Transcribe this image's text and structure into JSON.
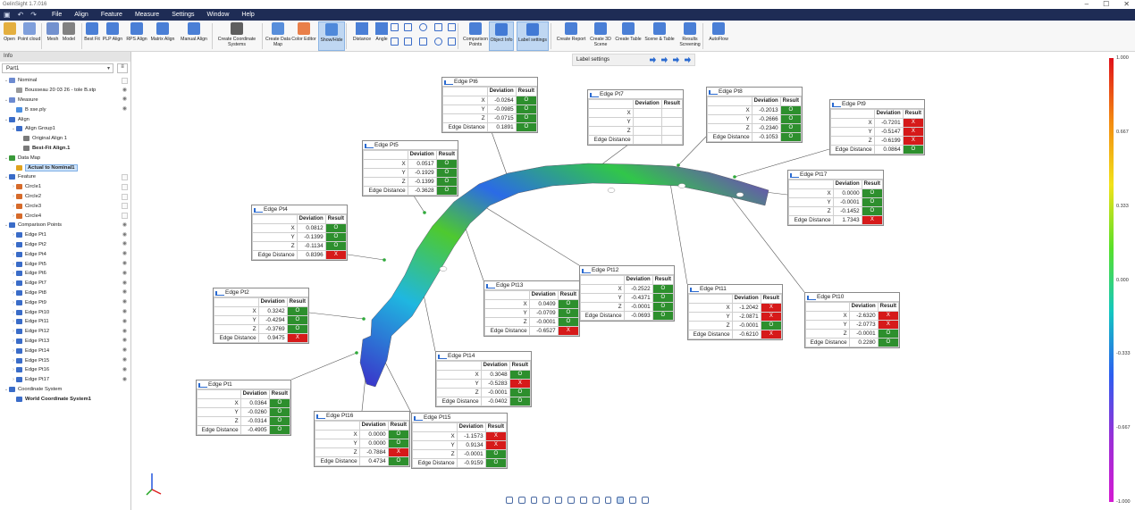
{
  "app": {
    "title": "GelinSight 1.7.016"
  },
  "menu": [
    "File",
    "Align",
    "Feature",
    "Measure",
    "Settings",
    "Window",
    "Help"
  ],
  "ribbon": {
    "buttons": [
      {
        "label": "Open",
        "icon": "folder-open-icon"
      },
      {
        "label": "Point cloud",
        "icon": "point-cloud-icon"
      },
      {
        "label": "Mesh",
        "icon": "mesh-icon"
      },
      {
        "label": "Model",
        "icon": "model-icon"
      },
      {
        "label": "Best Fit",
        "icon": "best-fit-icon"
      },
      {
        "label": "PLP Align",
        "icon": "plp-align-icon"
      },
      {
        "label": "RPS Align",
        "icon": "rps-align-icon"
      },
      {
        "label": "Matrix Align",
        "icon": "matrix-align-icon"
      },
      {
        "label": "Manual Align",
        "icon": "manual-align-icon"
      },
      {
        "label": "Create Coordinate Systems",
        "icon": "coordinate-system-icon"
      },
      {
        "label": "Create Data Map",
        "icon": "data-map-icon"
      },
      {
        "label": "Color Editor",
        "icon": "color-editor-icon"
      },
      {
        "label": "Show/Hide",
        "icon": "show-hide-icon"
      },
      {
        "label": "Distance",
        "icon": "distance-icon"
      },
      {
        "label": "Angle",
        "icon": "angle-icon"
      },
      {
        "label": "Comparison Points",
        "icon": "comparison-points-icon"
      },
      {
        "label": "Object Info",
        "icon": "object-info-icon"
      },
      {
        "label": "Label settings",
        "icon": "label-settings-icon"
      },
      {
        "label": "Create Report",
        "icon": "report-icon"
      },
      {
        "label": "Create 3D Scene",
        "icon": "scene-3d-icon"
      },
      {
        "label": "Create Table",
        "icon": "table-icon"
      },
      {
        "label": "Scene & Table",
        "icon": "scene-table-icon"
      },
      {
        "label": "Results Screening",
        "icon": "results-screening-icon"
      },
      {
        "label": "AutoFlow",
        "icon": "autoflow-icon"
      }
    ]
  },
  "panel": {
    "header": "Info",
    "part": "Part1",
    "tree": [
      {
        "label": "Nominal",
        "level": 0,
        "expander": "v",
        "right": "box"
      },
      {
        "label": "Bousseau 20 03 26 - tole B.stp",
        "level": 1,
        "expander": "",
        "right": "eye"
      },
      {
        "label": "Measure",
        "level": 0,
        "expander": "v",
        "right": "eye"
      },
      {
        "label": "B sse.ply",
        "level": 1,
        "expander": "",
        "right": "eye"
      },
      {
        "label": "Align",
        "level": 0,
        "expander": "v",
        "right": ""
      },
      {
        "label": "Align Group1",
        "level": 1,
        "expander": "v",
        "right": ""
      },
      {
        "label": "Original Align 1",
        "level": 2,
        "expander": "",
        "right": ""
      },
      {
        "label": "Best-Fit Align.1",
        "level": 2,
        "expander": "",
        "right": "",
        "bold": true
      },
      {
        "label": "Data Map",
        "level": 0,
        "expander": "v",
        "right": ""
      },
      {
        "label": "Actual to Nominal1",
        "level": 1,
        "expander": "",
        "right": "",
        "bold": true,
        "selected": true
      },
      {
        "label": "Feature",
        "level": 0,
        "expander": "v",
        "right": "box"
      },
      {
        "label": "Circle1",
        "level": 1,
        "expander": ">",
        "right": "box"
      },
      {
        "label": "Circle2",
        "level": 1,
        "expander": ">",
        "right": "box"
      },
      {
        "label": "Circle3",
        "level": 1,
        "expander": ">",
        "right": "box"
      },
      {
        "label": "Circle4",
        "level": 1,
        "expander": ">",
        "right": "box"
      },
      {
        "label": "Comparison Points",
        "level": 0,
        "expander": "v",
        "right": "eye"
      },
      {
        "label": "Edge Pt1",
        "level": 1,
        "expander": ">",
        "right": "eye"
      },
      {
        "label": "Edge Pt2",
        "level": 1,
        "expander": ">",
        "right": "eye"
      },
      {
        "label": "Edge Pt4",
        "level": 1,
        "expander": ">",
        "right": "eye"
      },
      {
        "label": "Edge Pt5",
        "level": 1,
        "expander": ">",
        "right": "eye"
      },
      {
        "label": "Edge Pt6",
        "level": 1,
        "expander": ">",
        "right": "eye"
      },
      {
        "label": "Edge Pt7",
        "level": 1,
        "expander": ">",
        "right": "eye"
      },
      {
        "label": "Edge Pt8",
        "level": 1,
        "expander": ">",
        "right": "eye"
      },
      {
        "label": "Edge Pt9",
        "level": 1,
        "expander": ">",
        "right": "eye"
      },
      {
        "label": "Edge Pt10",
        "level": 1,
        "expander": ">",
        "right": "eye"
      },
      {
        "label": "Edge Pt11",
        "level": 1,
        "expander": ">",
        "right": "eye"
      },
      {
        "label": "Edge Pt12",
        "level": 1,
        "expander": ">",
        "right": "eye"
      },
      {
        "label": "Edge Pt13",
        "level": 1,
        "expander": ">",
        "right": "eye"
      },
      {
        "label": "Edge Pt14",
        "level": 1,
        "expander": ">",
        "right": "eye"
      },
      {
        "label": "Edge Pt15",
        "level": 1,
        "expander": ">",
        "right": "eye"
      },
      {
        "label": "Edge Pt16",
        "level": 1,
        "expander": ">",
        "right": "eye"
      },
      {
        "label": "Edge Pt17",
        "level": 1,
        "expander": ">",
        "right": "eye"
      },
      {
        "label": "Coordinate System",
        "level": 0,
        "expander": "v",
        "right": ""
      },
      {
        "label": "World Coordinate System1",
        "level": 1,
        "expander": "",
        "right": "",
        "bold": true
      }
    ]
  },
  "label_settings": {
    "title": "Label settings"
  },
  "table_headers": {
    "deviation": "Deviation",
    "result": "Result",
    "edge_distance": "Edge Distance"
  },
  "points": [
    {
      "name": "Edge Pt1",
      "x": "0.0364",
      "y": "-0.0260",
      "z": "-0.0314",
      "ed": "-0.4905",
      "rx": "O",
      "ry": "O",
      "rz": "O",
      "red": "O"
    },
    {
      "name": "Edge Pt2",
      "x": "0.3242",
      "y": "-0.4294",
      "z": "-0.3769",
      "ed": "0.9475",
      "rx": "O",
      "ry": "O",
      "rz": "O",
      "red": "X"
    },
    {
      "name": "Edge Pt4",
      "x": "0.0812",
      "y": "-0.1399",
      "z": "-0.1134",
      "ed": "0.8396",
      "rx": "O",
      "ry": "O",
      "rz": "O",
      "red": "X"
    },
    {
      "name": "Edge Pt5",
      "x": "0.0517",
      "y": "-0.1929",
      "z": "-0.1399",
      "ed": "-0.3628",
      "rx": "O",
      "ry": "O",
      "rz": "O",
      "red": "O"
    },
    {
      "name": "Edge Pt6",
      "x": "-0.0264",
      "y": "-0.0985",
      "z": "-0.0715",
      "ed": "0.1891",
      "rx": "O",
      "ry": "O",
      "rz": "O",
      "red": "O"
    },
    {
      "name": "Edge Pt7",
      "x": "",
      "y": "",
      "z": "",
      "ed": "",
      "rx": "",
      "ry": "",
      "rz": "",
      "red": ""
    },
    {
      "name": "Edge Pt8",
      "x": "-0.2013",
      "y": "-0.2666",
      "z": "-0.2340",
      "ed": "-0.1053",
      "rx": "O",
      "ry": "O",
      "rz": "O",
      "red": "O"
    },
    {
      "name": "Edge Pt9",
      "x": "-0.7201",
      "y": "-0.5147",
      "z": "-0.6199",
      "ed": "0.0864",
      "rx": "X",
      "ry": "X",
      "rz": "X",
      "red": "O"
    },
    {
      "name": "Edge Pt17",
      "x": "0.0000",
      "y": "-0.0001",
      "z": "-0.1452",
      "ed": "1.7343",
      "rx": "O",
      "ry": "O",
      "rz": "O",
      "red": "X"
    },
    {
      "name": "Edge Pt12",
      "x": "-0.2522",
      "y": "-0.4371",
      "z": "-0.0001",
      "ed": "-0.0693",
      "rx": "O",
      "ry": "O",
      "rz": "O",
      "red": "O"
    },
    {
      "name": "Edge Pt13",
      "x": "0.0409",
      "y": "-0.0709",
      "z": "-0.0001",
      "ed": "-0.6527",
      "rx": "O",
      "ry": "O",
      "rz": "O",
      "red": "X"
    },
    {
      "name": "Edge Pt11",
      "x": "-1.2042",
      "y": "-2.0871",
      "z": "-0.0001",
      "ed": "-0.6210",
      "rx": "X",
      "ry": "X",
      "rz": "O",
      "red": "X"
    },
    {
      "name": "Edge Pt10",
      "x": "-2.6320",
      "y": "-2.0773",
      "z": "-0.0001",
      "ed": "0.2280",
      "rx": "X",
      "ry": "X",
      "rz": "O",
      "red": "O"
    },
    {
      "name": "Edge Pt14",
      "x": "0.3048",
      "y": "-0.5283",
      "z": "-0.0001",
      "ed": "-0.0402",
      "rx": "O",
      "ry": "X",
      "rz": "O",
      "red": "O"
    },
    {
      "name": "Edge Pt16",
      "x": "0.0000",
      "y": "0.0000",
      "z": "-0.7884",
      "ed": "0.4734",
      "rx": "O",
      "ry": "O",
      "rz": "X",
      "red": "O"
    },
    {
      "name": "Edge Pt15",
      "x": "-1.1573",
      "y": "0.9134",
      "z": "-0.0001",
      "ed": "-0.9159",
      "rx": "X",
      "ry": "X",
      "rz": "O",
      "red": "O"
    }
  ],
  "colorbar": {
    "labels": [
      "1.000",
      "0.667",
      "0.333",
      "0.000",
      "-0.333",
      "-0.667",
      "-1.000"
    ]
  },
  "colors": {
    "ok": "#2d8f2d",
    "ng": "#d61a1a",
    "menubar": "#1e2c55",
    "selection": "#cde3fb"
  }
}
